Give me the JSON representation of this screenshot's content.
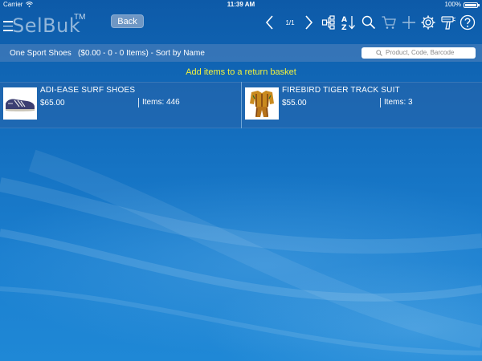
{
  "status_bar": {
    "carrier": "Carrier",
    "time": "11:39 AM",
    "battery": "100%",
    "battery_level": 1.0
  },
  "toolbar": {
    "brand": "SelBuk",
    "brand_mark": "TM",
    "back_label": "Back",
    "page_indicator": "1/1",
    "icons": [
      "menu-icon",
      "chevron-left-icon",
      "chevron-right-icon",
      "category-tree-icon",
      "sort-az-icon",
      "search-icon",
      "cart-icon",
      "plus-icon",
      "gear-icon",
      "barcode-scanner-icon",
      "help-icon"
    ]
  },
  "info_bar": {
    "title": "One Sport Shoes   ($0.00 - 0 - 0 Items) - Sort by Name",
    "search_placeholder": "Product, Code, Barcode"
  },
  "banner": {
    "text": "Add items to a return basket",
    "color": "#f1f13d"
  },
  "products": [
    {
      "name": "ADI-EASE SURF SHOES",
      "price": "$65.00",
      "qty": "Items: 446",
      "image": "shoe"
    },
    {
      "name": "FIREBIRD TIGER TRACK SUIT",
      "price": "$55.00",
      "qty": "Items: 3",
      "image": "track-suit"
    }
  ],
  "colors": {
    "background": "#1573c4",
    "banner_text": "#f1f13d",
    "back_button": "#6f97c4"
  }
}
